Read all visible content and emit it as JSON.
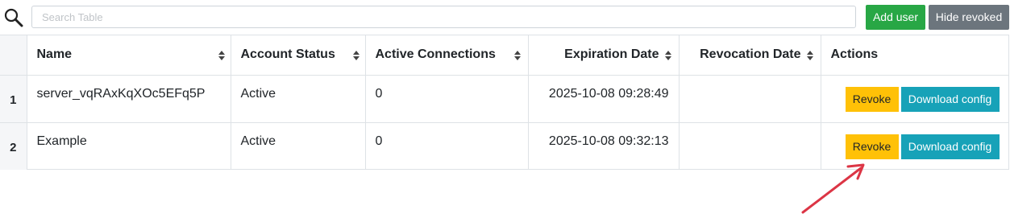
{
  "search": {
    "placeholder": "Search Table",
    "icon": "search-icon"
  },
  "toolbar": {
    "add_user_label": "Add user",
    "hide_revoked_label": "Hide revoked",
    "add_color": "#28a745",
    "hide_color": "#6c757d"
  },
  "table": {
    "columns": [
      "Name",
      "Account Status",
      "Active Connections",
      "Expiration Date",
      "Revocation Date",
      "Actions"
    ],
    "rows": [
      {
        "index": "1",
        "name": "server_vqRAxKqXOc5EFq5P",
        "status": "Active",
        "connections": "0",
        "expiration": "2025-10-08 09:28:49",
        "revocation": "",
        "revoke_label": "Revoke",
        "download_label": "Download config"
      },
      {
        "index": "2",
        "name": "Example",
        "status": "Active",
        "connections": "0",
        "expiration": "2025-10-08 09:32:13",
        "revocation": "",
        "revoke_label": "Revoke",
        "download_label": "Download config"
      }
    ]
  },
  "colors": {
    "revoke": "#ffc107",
    "download": "#17a2b8",
    "annotation_arrow": "#dc3545"
  }
}
